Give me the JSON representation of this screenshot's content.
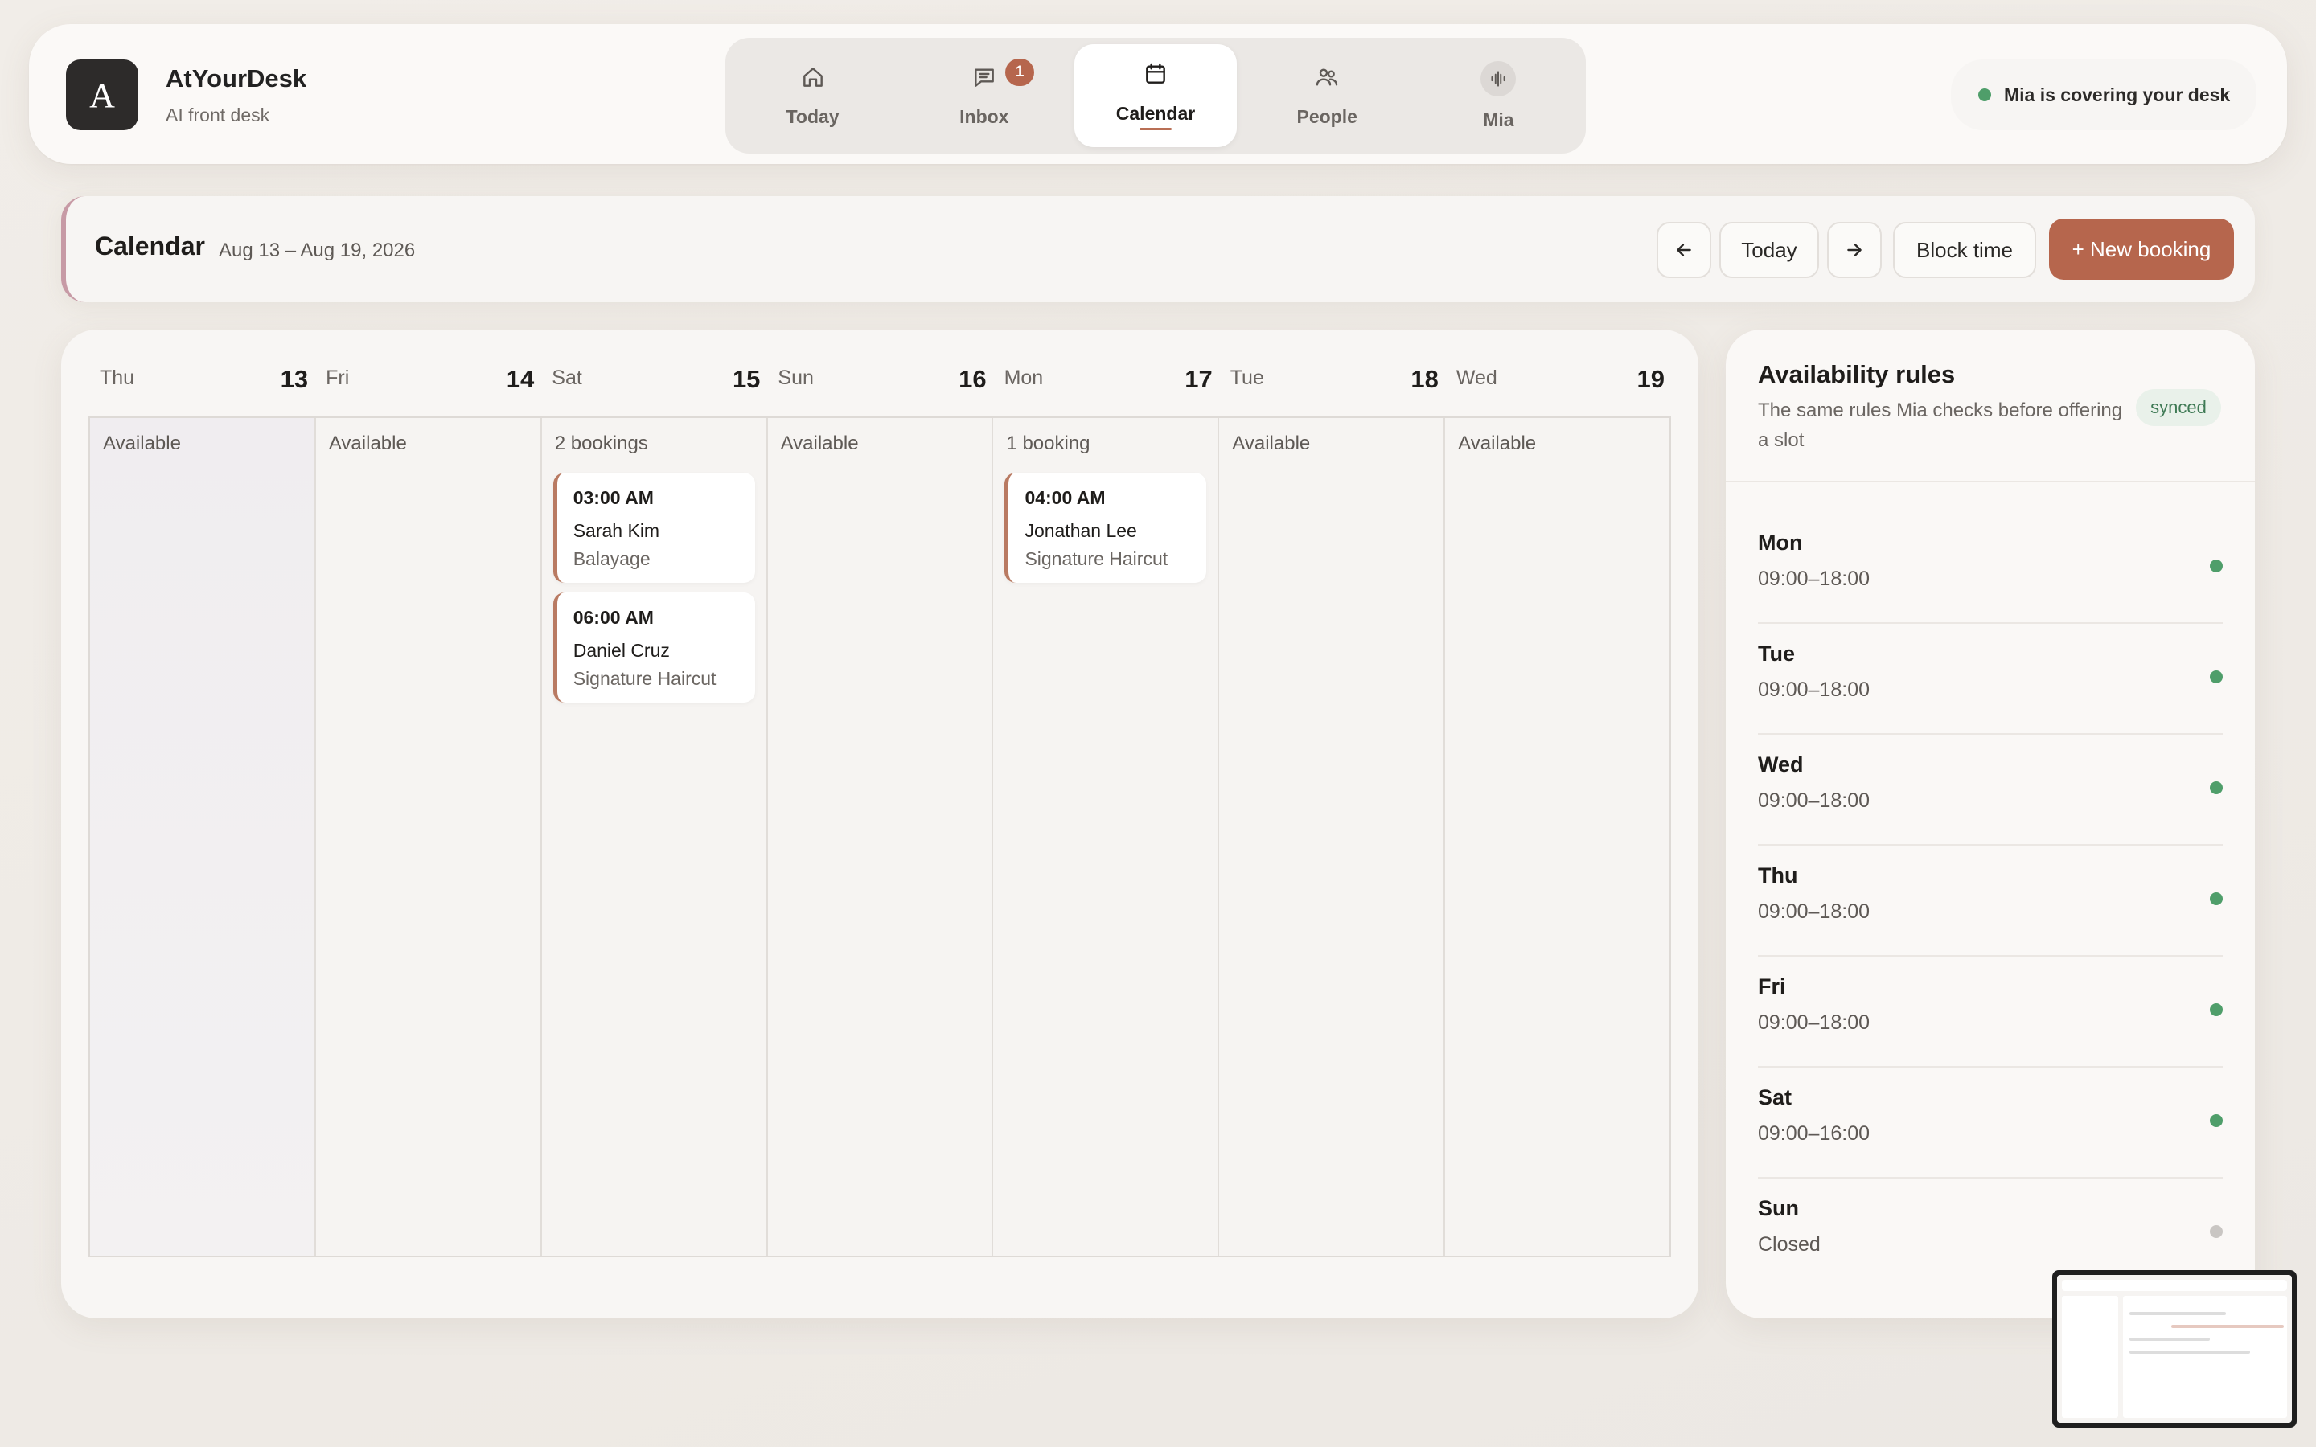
{
  "app": {
    "logo_letter": "A",
    "name": "AtYourDesk",
    "tagline": "AI front desk"
  },
  "nav": [
    {
      "label": "Today",
      "icon": "home-icon"
    },
    {
      "label": "Inbox",
      "icon": "chat-icon",
      "badge": "1"
    },
    {
      "label": "Calendar",
      "icon": "calendar-icon",
      "active": true
    },
    {
      "label": "People",
      "icon": "people-icon"
    },
    {
      "label": "Mia",
      "icon": "waveform-icon"
    }
  ],
  "status": {
    "text": "Mia is covering your desk",
    "color": "#4f9e6a"
  },
  "toolbar": {
    "title": "Calendar",
    "range": "Aug 13 – Aug 19, 2026",
    "today_label": "Today",
    "block_label": "Block time",
    "new_label": "+ New booking",
    "accent": "#b6664d"
  },
  "calendar": {
    "days": [
      {
        "name": "Thu",
        "num": "13",
        "status": "Available",
        "bookings": []
      },
      {
        "name": "Fri",
        "num": "14",
        "status": "Available",
        "bookings": []
      },
      {
        "name": "Sat",
        "num": "15",
        "status": "2 bookings",
        "bookings": [
          {
            "time": "03:00 AM",
            "client": "Sarah Kim",
            "service": "Balayage"
          },
          {
            "time": "06:00 AM",
            "client": "Daniel Cruz",
            "service": "Signature Haircut"
          }
        ]
      },
      {
        "name": "Sun",
        "num": "16",
        "status": "Available",
        "bookings": []
      },
      {
        "name": "Mon",
        "num": "17",
        "status": "1 booking",
        "bookings": [
          {
            "time": "04:00 AM",
            "client": "Jonathan Lee",
            "service": "Signature Haircut"
          }
        ]
      },
      {
        "name": "Tue",
        "num": "18",
        "status": "Available",
        "bookings": []
      },
      {
        "name": "Wed",
        "num": "19",
        "status": "Available",
        "bookings": []
      }
    ]
  },
  "availability": {
    "title": "Availability rules",
    "subtitle": "The same rules Mia checks before offering a slot",
    "badge": "synced",
    "rules": [
      {
        "day": "Mon",
        "hours": "09:00–18:00",
        "open": true
      },
      {
        "day": "Tue",
        "hours": "09:00–18:00",
        "open": true
      },
      {
        "day": "Wed",
        "hours": "09:00–18:00",
        "open": true
      },
      {
        "day": "Thu",
        "hours": "09:00–18:00",
        "open": true
      },
      {
        "day": "Fri",
        "hours": "09:00–18:00",
        "open": true
      },
      {
        "day": "Sat",
        "hours": "09:00–16:00",
        "open": true
      },
      {
        "day": "Sun",
        "hours": "Closed",
        "open": false
      }
    ]
  }
}
